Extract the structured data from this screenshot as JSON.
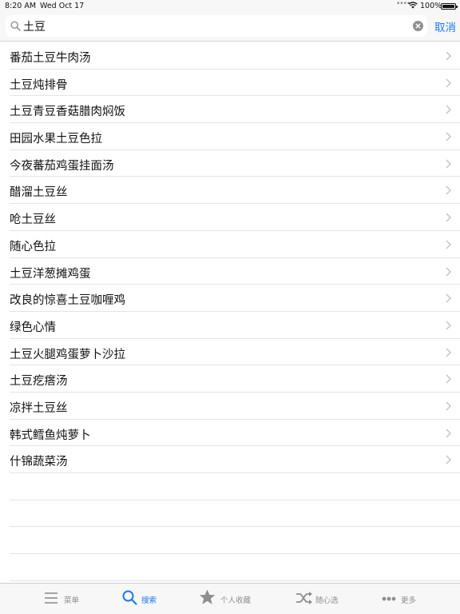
{
  "status_bar": {
    "time": "8:20 AM",
    "date": "Wed Oct 17",
    "battery_percent": "100%"
  },
  "search": {
    "query": "土豆",
    "cancel_label": "取消"
  },
  "results": [
    {
      "label": "番茄土豆牛肉汤"
    },
    {
      "label": "土豆炖排骨"
    },
    {
      "label": "土豆青豆香菇腊肉焖饭"
    },
    {
      "label": "田园水果土豆色拉"
    },
    {
      "label": "今夜蕃茄鸡蛋挂面汤"
    },
    {
      "label": "醋溜土豆丝"
    },
    {
      "label": "呛土豆丝"
    },
    {
      "label": "随心色拉"
    },
    {
      "label": "土豆洋葱摊鸡蛋"
    },
    {
      "label": "改良的惊喜土豆咖喱鸡"
    },
    {
      "label": "绿色心情"
    },
    {
      "label": "土豆火腿鸡蛋萝卜沙拉"
    },
    {
      "label": "土豆疙瘩汤"
    },
    {
      "label": "凉拌土豆丝"
    },
    {
      "label": "韩式鳕鱼炖萝卜"
    },
    {
      "label": "什锦蔬菜汤"
    }
  ],
  "tab_bar": {
    "tabs": [
      {
        "label": "菜单",
        "icon": "menu-icon"
      },
      {
        "label": "搜索",
        "icon": "search-icon",
        "active": true
      },
      {
        "label": "个人收藏",
        "icon": "star-icon"
      },
      {
        "label": "随心选",
        "icon": "shuffle-icon"
      },
      {
        "label": "更多",
        "icon": "more-icon"
      }
    ]
  },
  "colors": {
    "accent": "#1a7cf5",
    "inactive": "#8e8e8e",
    "bar_background": "#f7f7f7"
  }
}
